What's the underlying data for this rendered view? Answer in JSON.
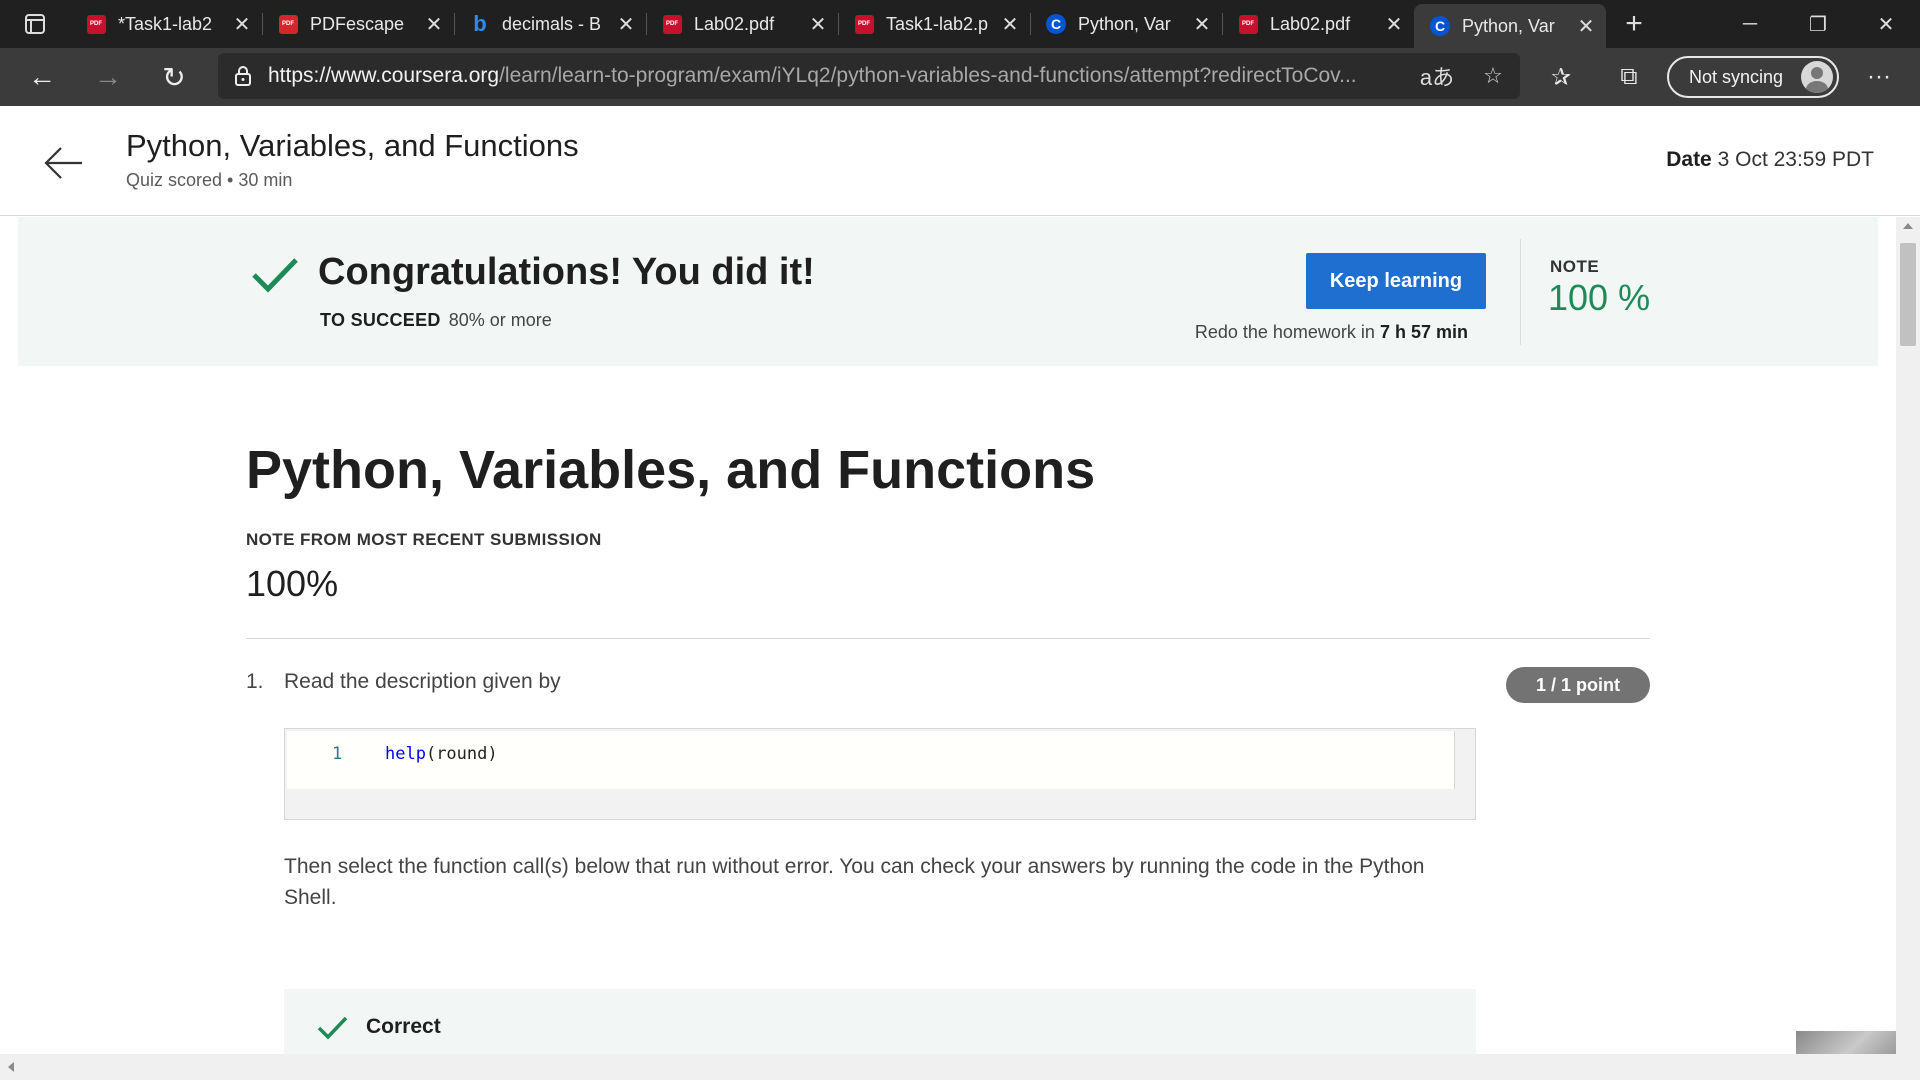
{
  "browser": {
    "tabs": [
      {
        "title": "*Task1-lab2",
        "icon": "pdf-icon"
      },
      {
        "title": "PDFescape",
        "icon": "pdfescape-icon"
      },
      {
        "title": "decimals - B",
        "icon": "bing-icon"
      },
      {
        "title": "Lab02.pdf",
        "icon": "pdf-icon"
      },
      {
        "title": "Task1-lab2.p",
        "icon": "pdf-icon"
      },
      {
        "title": "Python, Var",
        "icon": "coursera-icon"
      },
      {
        "title": "Lab02.pdf",
        "icon": "pdf-icon"
      },
      {
        "title": "Python, Var",
        "icon": "coursera-icon",
        "active": true
      }
    ],
    "url_prefix": "https://",
    "url_host": "www.coursera.org",
    "url_path": "/learn/learn-to-program/exam/iYLq2/python-variables-and-functions/attempt?redirectToCov...",
    "sync_label": "Not syncing"
  },
  "header": {
    "title": "Python, Variables, and Functions",
    "subtitle": "Quiz scored • 30 min",
    "date_label": "Date",
    "date_value": "3 Oct 23:59 PDT"
  },
  "banner": {
    "heading": "Congratulations! You did it!",
    "succeed_label": "TO SUCCEED",
    "succeed_value": "80% or more",
    "button_label": "Keep learning",
    "redo_prefix": "Redo the homework in",
    "redo_time": "7 h 57 min",
    "note_label": "NOTE",
    "note_value": "100 %",
    "accent_color": "#1e8a5a"
  },
  "main": {
    "title": "Python, Variables, and Functions",
    "recent_label": "NOTE FROM MOST RECENT SUBMISSION",
    "recent_value": "100%"
  },
  "question": {
    "number": "1.",
    "text": "Read the description given by",
    "points": "1 / 1 point",
    "code_line_number": "1",
    "code_fn": "help",
    "code_rest": "(round)",
    "instruction": "Then select the function call(s) below that run without error. You can check your answers by running the code in the Python Shell.",
    "feedback": "Correct"
  }
}
